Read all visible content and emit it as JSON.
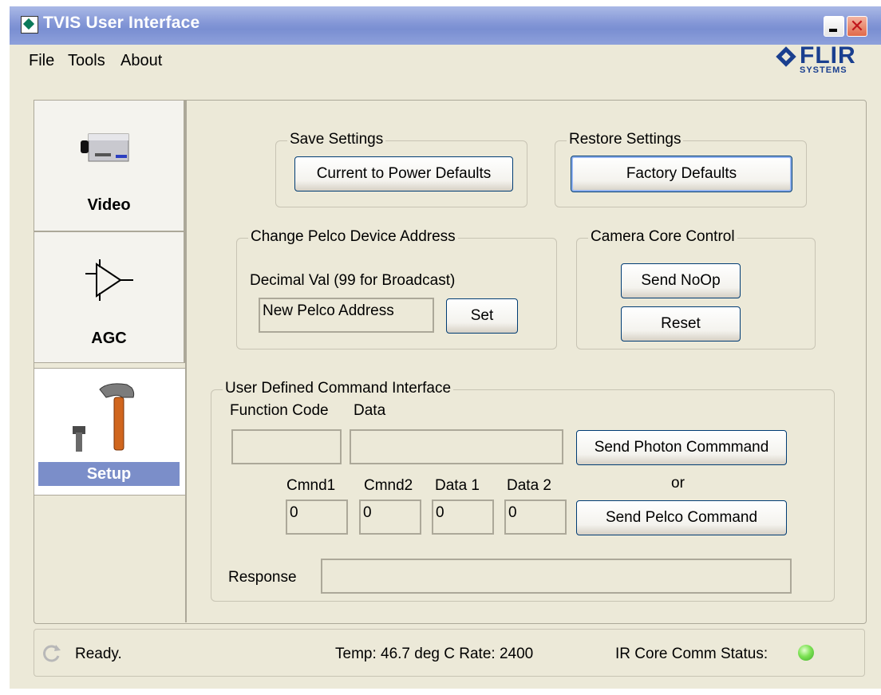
{
  "window": {
    "title": "TVIS User Interface"
  },
  "menu": {
    "items": [
      "File",
      "Tools",
      "About"
    ]
  },
  "logo": {
    "word": "FLIR",
    "sub": "SYSTEMS"
  },
  "tabs": [
    {
      "label": "Video",
      "icon": "video-camera-icon"
    },
    {
      "label": "AGC",
      "icon": "amplifier-icon"
    },
    {
      "label": "Setup",
      "icon": "hammer-tools-icon",
      "selected": true
    }
  ],
  "save_settings": {
    "title": "Save Settings",
    "button": "Current to Power Defaults"
  },
  "restore_settings": {
    "title": "Restore Settings",
    "button": "Factory Defaults"
  },
  "pelco_address": {
    "title": "Change Pelco Device Address",
    "hint": "Decimal Val (99 for Broadcast)",
    "input_value": "New Pelco Address",
    "set_button": "Set"
  },
  "camera_core": {
    "title": "Camera Core Control",
    "noop_button": "Send NoOp",
    "reset_button": "Reset"
  },
  "user_command": {
    "title": "User Defined Command Interface",
    "function_code_label": "Function Code",
    "data_label": "Data",
    "function_code_value": "",
    "data_value": "",
    "send_photon_button": "Send Photon Commmand",
    "or_label": "or",
    "cmnd1_label": "Cmnd1",
    "cmnd2_label": "Cmnd2",
    "data1_label": "Data 1",
    "data2_label": "Data 2",
    "cmnd1_value": "0",
    "cmnd2_value": "0",
    "data1_value": "0",
    "data2_value": "0",
    "send_pelco_button": "Send Pelco Command",
    "response_label": "Response",
    "response_value": ""
  },
  "status": {
    "ready_text": "Ready.",
    "temp_rate_text": "Temp: 46.7 deg C  Rate: 2400",
    "comm_status_label": "IR Core Comm Status:",
    "comm_status_color": "#5fd13a"
  },
  "colors": {
    "window_bg": "#ECE9D8",
    "title_bar": "#8396d6",
    "selected_tab_label": "#7b8ec9",
    "brand_blue": "#1a3f8f"
  }
}
